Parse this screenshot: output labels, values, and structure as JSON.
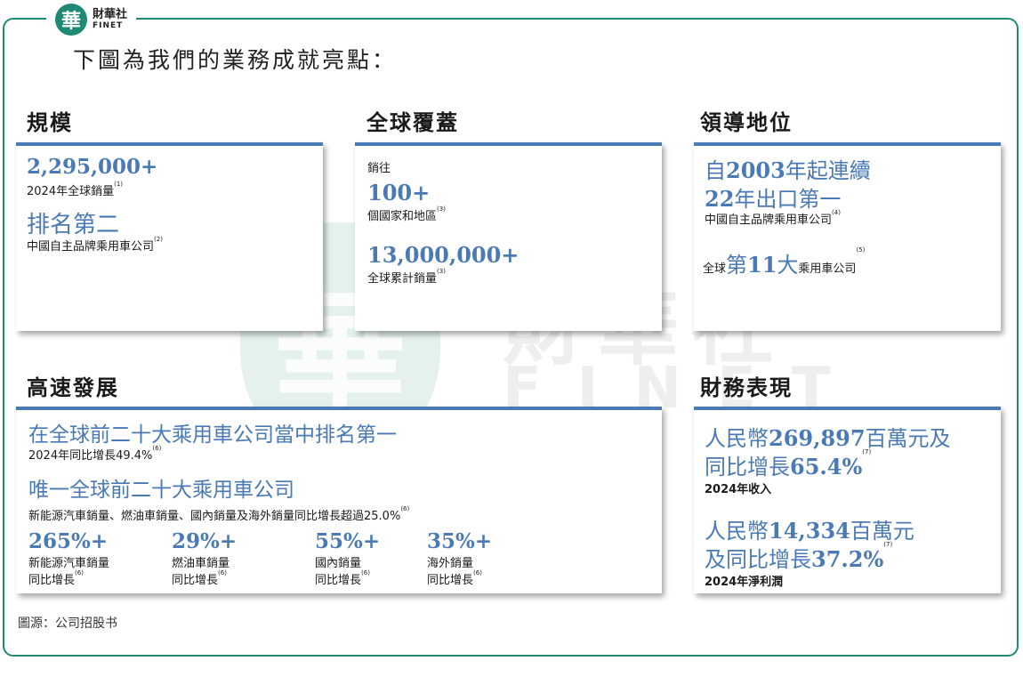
{
  "logo": {
    "mark": "華",
    "cn": "財華社",
    "en": "FINET"
  },
  "headline": "下圖為我們的業務成就亮點：",
  "watermark": {
    "mark": "華",
    "cn": "財華社",
    "en": "FINET"
  },
  "sections": {
    "scale": {
      "title": "規模",
      "value1": "2,295,000+",
      "label1": "2024年全球銷量",
      "note1": "(1)",
      "value2": "排名第二",
      "label2": "中國自主品牌乘用車公司",
      "note2": "(2)"
    },
    "global": {
      "title": "全球覆蓋",
      "prefix": "銷往",
      "value1": "100+",
      "label1": "個國家和地區",
      "note1": "(3)",
      "value2": "13,000,000+",
      "label2": "全球累計銷量",
      "note2": "(3)"
    },
    "leader": {
      "title": "領導地位",
      "line1_a": "自",
      "line1_b": "2003",
      "line1_c": "年起連續",
      "line2_a": "22",
      "line2_b": "年出口第一",
      "label1": "中國自主品牌乘用車公司",
      "note1": "(4)",
      "rank_prefix": "全球",
      "rank_a": "第",
      "rank_b": "11",
      "rank_c": "大",
      "rank_suffix": "乘用車公司",
      "note2": "(5)"
    },
    "growth": {
      "title": "高速發展",
      "headline1": "在全球前二十大乘用車公司當中排名第一",
      "sub1": "2024年同比增長49.4%",
      "note1": "(6)",
      "headline2": "唯一全球前二十大乘用車公司",
      "sub2": "新能源汽車銷量、燃油車銷量、國內銷量及海外銷量同比增長超過25.0%",
      "note2": "(6)",
      "stats": [
        {
          "value": "265%+",
          "label1": "新能源汽車銷量",
          "label2": "同比增長",
          "note": "(6)"
        },
        {
          "value": "29%+",
          "label1": "燃油車銷量",
          "label2": "同比增長",
          "note": "(6)"
        },
        {
          "value": "55%+",
          "label1": "國內銷量",
          "label2": "同比增長",
          "note": "(6)"
        },
        {
          "value": "35%+",
          "label1": "海外銷量",
          "label2": "同比增長",
          "note": "(6)"
        }
      ]
    },
    "finance": {
      "title": "財務表現",
      "rev_a": "人民幣",
      "rev_b": "269,897",
      "rev_c": "百萬元及",
      "rev2_a": "同比增長",
      "rev2_b": "65.4%",
      "rev_note": "(7)",
      "rev_label": "2024年收入",
      "np_a": "人民幣",
      "np_b": "14,334",
      "np_c": "百萬元",
      "np2_a": "及同比增長",
      "np2_b": "37.2%",
      "np_note": "(7)",
      "np_label": "2024年淨利潤"
    }
  },
  "source": "圖源：公司招股书",
  "colors": {
    "accent": "#4a7ab5",
    "frame": "#1f8a73"
  }
}
